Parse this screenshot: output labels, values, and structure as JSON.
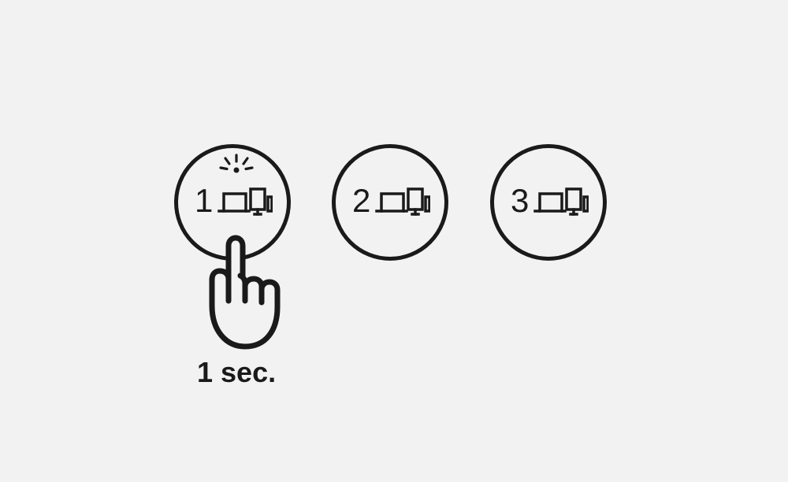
{
  "instruction": {
    "press_duration_label": "1 sec.",
    "press_target_index": 0
  },
  "buttons": [
    {
      "number": "1",
      "has_flash": true,
      "is_pressed": true
    },
    {
      "number": "2",
      "has_flash": false,
      "is_pressed": false
    },
    {
      "number": "3",
      "has_flash": false,
      "is_pressed": false
    }
  ],
  "icons": {
    "flash": "flash-indicator-icon",
    "devices": "devices-icon",
    "hand": "press-hand-icon"
  }
}
